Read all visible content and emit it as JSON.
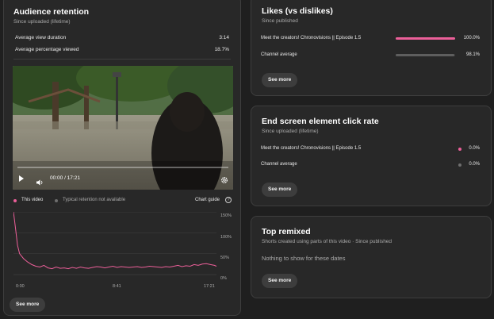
{
  "retention": {
    "title": "Audience retention",
    "subtitle": "Since uploaded (lifetime)",
    "avg_view_label": "Average view duration",
    "avg_view_value": "3:14",
    "avg_pct_label": "Average percentage viewed",
    "avg_pct_value": "18.7%",
    "player": {
      "time": "00:00 / 17:21"
    },
    "legend_this": "This video",
    "legend_typical": "Typical retention not available",
    "chart_guide": "Chart guide",
    "see_more": "See more"
  },
  "likes": {
    "title": "Likes (vs dislikes)",
    "subtitle": "Since published",
    "rows": [
      {
        "label": "Meet the creators! Chronovisions || Episode 1.5",
        "value": "100.0%",
        "fraction": 1.0,
        "color": "#ec5f99"
      },
      {
        "label": "Channel average",
        "value": "98.1%",
        "fraction": 0.981,
        "color": "#5e5e5e"
      }
    ],
    "see_more": "See more"
  },
  "endscreen": {
    "title": "End screen element click rate",
    "subtitle": "Since uploaded (lifetime)",
    "rows": [
      {
        "label": "Meet the creators! Chronovisions || Episode 1.5",
        "value": "0.0%",
        "color": "#ec5f99"
      },
      {
        "label": "Channel average",
        "value": "0.0%",
        "color": "#6e6e6e"
      }
    ],
    "see_more": "See more"
  },
  "remixed": {
    "title": "Top remixed",
    "subtitle": "Shorts created using parts of this video · Since published",
    "empty": "Nothing to show for these dates",
    "see_more": "See more"
  },
  "chart_data": {
    "type": "line",
    "x_ticks": [
      "0:00",
      "8:41",
      "17:21"
    ],
    "y_ticks": [
      "150%",
      "100%",
      "50%",
      "0%"
    ],
    "ylim": [
      0,
      150
    ],
    "grid": true,
    "series": [
      {
        "name": "This video",
        "color": "#ec5f99",
        "x": [
          0,
          0.01,
          0.02,
          0.03,
          0.05,
          0.07,
          0.09,
          0.11,
          0.13,
          0.15,
          0.17,
          0.19,
          0.21,
          0.23,
          0.25,
          0.27,
          0.29,
          0.31,
          0.33,
          0.35,
          0.37,
          0.39,
          0.41,
          0.43,
          0.45,
          0.47,
          0.49,
          0.51,
          0.53,
          0.55,
          0.57,
          0.59,
          0.61,
          0.63,
          0.65,
          0.67,
          0.69,
          0.71,
          0.73,
          0.75,
          0.77,
          0.79,
          0.81,
          0.83,
          0.85,
          0.87,
          0.89,
          0.91,
          0.93,
          0.95,
          0.97,
          0.99,
          1.0
        ],
        "values": [
          150,
          110,
          70,
          50,
          38,
          30,
          24,
          20,
          18,
          22,
          16,
          14,
          18,
          15,
          16,
          14,
          17,
          15,
          18,
          16,
          15,
          17,
          19,
          18,
          16,
          18,
          20,
          17,
          19,
          18,
          17,
          18,
          19,
          17,
          18,
          20,
          19,
          18,
          17,
          19,
          18,
          20,
          22,
          19,
          21,
          20,
          24,
          22,
          25,
          26,
          24,
          22,
          20
        ]
      }
    ]
  }
}
